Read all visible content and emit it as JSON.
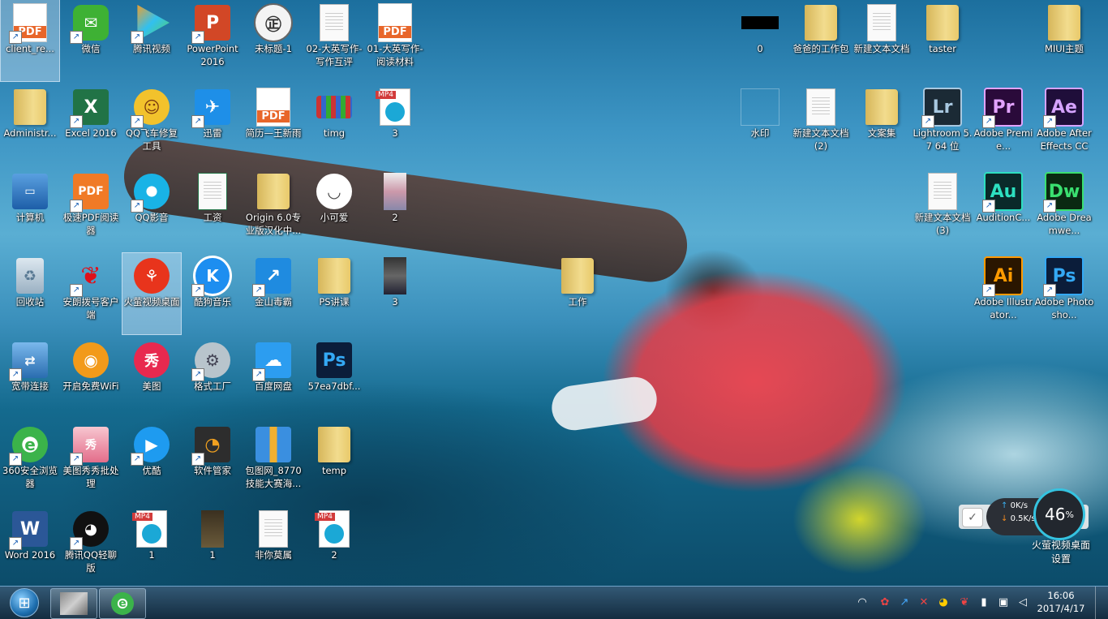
{
  "desktop": {
    "icons": [
      {
        "label": "client_re...",
        "kind": "pdf"
      },
      {
        "label": "微信",
        "kind": "wechat"
      },
      {
        "label": "腾讯视频",
        "kind": "txvideo"
      },
      {
        "label": "PowerPoint 2016",
        "kind": "ppt"
      },
      {
        "label": "未标题-1",
        "kind": "seal"
      },
      {
        "label": "02-大英写作-写作互评",
        "kind": "word-doc"
      },
      {
        "label": "01-大英写作-阅读材料",
        "kind": "pdf"
      },
      {
        "label": "Administr...",
        "kind": "user-folder"
      },
      {
        "label": "Excel 2016",
        "kind": "excel"
      },
      {
        "label": "QQ飞车修复工具",
        "kind": "qqcar"
      },
      {
        "label": "迅雷",
        "kind": "xunlei"
      },
      {
        "label": "简历—王新雨",
        "kind": "pdf"
      },
      {
        "label": "timg",
        "kind": "image"
      },
      {
        "label": "3",
        "kind": "mp4"
      },
      {
        "label": "计算机",
        "kind": "computer"
      },
      {
        "label": "极速PDF阅读器",
        "kind": "pdfreader"
      },
      {
        "label": "QQ影音",
        "kind": "qqplayer"
      },
      {
        "label": "工资",
        "kind": "excel-doc"
      },
      {
        "label": "Origin 6.0专业版汉化中...",
        "kind": "folder"
      },
      {
        "label": "小可爱",
        "kind": "cute"
      },
      {
        "label": "2",
        "kind": "thumb"
      },
      {
        "label": "回收站",
        "kind": "recycle"
      },
      {
        "label": "安朗拨号客户端",
        "kind": "butterfly"
      },
      {
        "label": "火萤视频桌面",
        "kind": "huoying"
      },
      {
        "label": "酷狗音乐",
        "kind": "kugou"
      },
      {
        "label": "金山毒霸",
        "kind": "duba"
      },
      {
        "label": "PS讲课",
        "kind": "folder"
      },
      {
        "label": "3",
        "kind": "thumb"
      },
      {
        "label": "宽带连接",
        "kind": "network"
      },
      {
        "label": "开启免费WiFi",
        "kind": "wifi"
      },
      {
        "label": "美图",
        "kind": "meitu"
      },
      {
        "label": "格式工厂",
        "kind": "format"
      },
      {
        "label": "百度网盘",
        "kind": "baidu"
      },
      {
        "label": "57ea7dbf...",
        "kind": "psd"
      },
      {
        "label": "360安全浏览器",
        "kind": "360"
      },
      {
        "label": "美图秀秀批处理",
        "kind": "meitubatch"
      },
      {
        "label": "优酷",
        "kind": "youku"
      },
      {
        "label": "软件管家",
        "kind": "softmgr"
      },
      {
        "label": "包图网_8770技能大赛海...",
        "kind": "zip"
      },
      {
        "label": "temp",
        "kind": "folder"
      },
      {
        "label": "Word 2016",
        "kind": "word"
      },
      {
        "label": "腾讯QQ轻聊版",
        "kind": "qq"
      },
      {
        "label": "1",
        "kind": "mp4"
      },
      {
        "label": "1",
        "kind": "thumb"
      },
      {
        "label": "非你莫属",
        "kind": "word-doc"
      },
      {
        "label": "2",
        "kind": "mp4"
      },
      {
        "label": "工作",
        "kind": "folder"
      },
      {
        "label": "0",
        "kind": "black"
      },
      {
        "label": "爸爸的工作包",
        "kind": "folder"
      },
      {
        "label": "新建文本文档",
        "kind": "txt"
      },
      {
        "label": "taster",
        "kind": "folder"
      },
      {
        "label": "MIUI主题",
        "kind": "folder"
      },
      {
        "label": "水印",
        "kind": "blank"
      },
      {
        "label": "新建文本文档 (2)",
        "kind": "txt"
      },
      {
        "label": "文案集",
        "kind": "folder"
      },
      {
        "label": "Lightroom 5.7 64 位",
        "kind": "lr"
      },
      {
        "label": "Adobe Premie...",
        "kind": "pr"
      },
      {
        "label": "Adobe After Effects CC",
        "kind": "ae"
      },
      {
        "label": "新建文本文档 (3)",
        "kind": "txt"
      },
      {
        "label": "AuditionC...",
        "kind": "au"
      },
      {
        "label": "Adobe Dreamwe...",
        "kind": "dw"
      },
      {
        "label": "Adobe Illustrator...",
        "kind": "ai"
      },
      {
        "label": "Adobe Photosho...",
        "kind": "ps"
      }
    ]
  },
  "widget": {
    "upload": "0K/s",
    "download": "0.5K/s",
    "percent": "46",
    "percent_sign": "%",
    "label": "火萤视频桌面设置"
  },
  "taskbar": {
    "time": "16:06",
    "date": "2017/4/17"
  }
}
